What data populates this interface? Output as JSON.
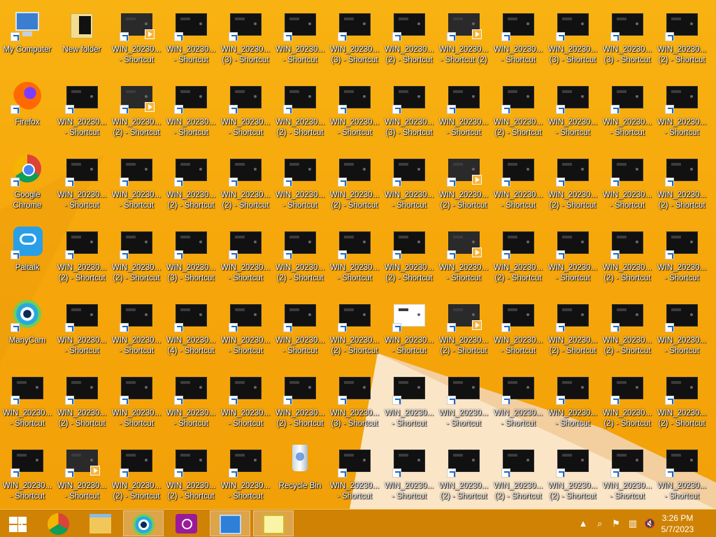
{
  "desktop_icons": [
    {
      "label1": "My Computer",
      "label2": "",
      "icon": "computer-icon",
      "kind": "computer",
      "col": 0,
      "row": 0
    },
    {
      "label1": "New folder",
      "label2": "",
      "icon": "folder-icon",
      "kind": "folder",
      "col": 1,
      "row": 0
    },
    {
      "label1": "WIN_20230...",
      "label2": "- Shortcut",
      "icon": "video-shortcut-icon",
      "kind": "video",
      "col": 2,
      "row": 0
    },
    {
      "label1": "WIN_20230...",
      "label2": "- Shortcut",
      "icon": "image-shortcut-icon",
      "kind": "thumb",
      "col": 3,
      "row": 0
    },
    {
      "label1": "WIN_20230...",
      "label2": "(3) - Shortcut",
      "icon": "image-shortcut-icon",
      "kind": "thumb",
      "col": 4,
      "row": 0
    },
    {
      "label1": "WIN_20230...",
      "label2": "- Shortcut",
      "icon": "image-shortcut-icon",
      "kind": "thumb",
      "col": 5,
      "row": 0
    },
    {
      "label1": "WIN_20230...",
      "label2": "(3) - Shortcut",
      "icon": "image-shortcut-icon",
      "kind": "thumb",
      "col": 6,
      "row": 0
    },
    {
      "label1": "WIN_20230...",
      "label2": "(2) - Shortcut",
      "icon": "image-shortcut-icon",
      "kind": "thumb",
      "col": 7,
      "row": 0
    },
    {
      "label1": "WIN_20230...",
      "label2": "- Shortcut (2)",
      "icon": "video-shortcut-icon",
      "kind": "video",
      "col": 8,
      "row": 0
    },
    {
      "label1": "WIN_20230...",
      "label2": "- Shortcut",
      "icon": "image-shortcut-icon",
      "kind": "thumb",
      "col": 9,
      "row": 0
    },
    {
      "label1": "WIN_20230...",
      "label2": "(3) - Shortcut",
      "icon": "image-shortcut-icon",
      "kind": "thumb",
      "col": 10,
      "row": 0
    },
    {
      "label1": "WIN_20230...",
      "label2": "(3) - Shortcut",
      "icon": "image-shortcut-icon",
      "kind": "thumb",
      "col": 11,
      "row": 0
    },
    {
      "label1": "WIN_20230...",
      "label2": "(2) - Shortcut",
      "icon": "image-shortcut-icon",
      "kind": "thumb",
      "col": 12,
      "row": 0
    },
    {
      "label1": "Firefox",
      "label2": "",
      "icon": "firefox-icon",
      "kind": "firefox",
      "col": 0,
      "row": 1
    },
    {
      "label1": "WIN_20230...",
      "label2": "- Shortcut",
      "icon": "image-shortcut-icon",
      "kind": "thumb",
      "col": 1,
      "row": 1
    },
    {
      "label1": "WIN_20230...",
      "label2": "(2) - Shortcut",
      "icon": "video-shortcut-icon",
      "kind": "video",
      "col": 2,
      "row": 1
    },
    {
      "label1": "WIN_20230...",
      "label2": "- Shortcut",
      "icon": "image-shortcut-icon",
      "kind": "thumb",
      "col": 3,
      "row": 1
    },
    {
      "label1": "WIN_20230...",
      "label2": "- Shortcut",
      "icon": "image-shortcut-icon",
      "kind": "thumb",
      "col": 4,
      "row": 1
    },
    {
      "label1": "WIN_20230...",
      "label2": "(2) - Shortcut",
      "icon": "image-shortcut-icon",
      "kind": "thumb",
      "col": 5,
      "row": 1
    },
    {
      "label1": "WIN_20230...",
      "label2": "- Shortcut",
      "icon": "image-shortcut-icon",
      "kind": "thumb",
      "col": 6,
      "row": 1
    },
    {
      "label1": "WIN_20230...",
      "label2": "(3) - Shortcut",
      "icon": "image-shortcut-icon",
      "kind": "thumb",
      "col": 7,
      "row": 1
    },
    {
      "label1": "WIN_20230...",
      "label2": "- Shortcut",
      "icon": "image-shortcut-icon",
      "kind": "thumb",
      "col": 8,
      "row": 1
    },
    {
      "label1": "WIN_20230...",
      "label2": "(2) - Shortcut",
      "icon": "image-shortcut-icon",
      "kind": "thumb",
      "col": 9,
      "row": 1
    },
    {
      "label1": "WIN_20230...",
      "label2": "- Shortcut",
      "icon": "image-shortcut-icon",
      "kind": "thumb",
      "col": 10,
      "row": 1
    },
    {
      "label1": "WIN_20230...",
      "label2": "- Shortcut",
      "icon": "image-shortcut-icon",
      "kind": "thumb",
      "col": 11,
      "row": 1
    },
    {
      "label1": "WIN_20230...",
      "label2": "- Shortcut",
      "icon": "image-shortcut-icon",
      "kind": "thumb",
      "col": 12,
      "row": 1
    },
    {
      "label1": "Google",
      "label2": "Chrome",
      "icon": "chrome-icon",
      "kind": "chrome",
      "col": 0,
      "row": 2
    },
    {
      "label1": "WIN_20230...",
      "label2": "- Shortcut",
      "icon": "image-shortcut-icon",
      "kind": "thumb",
      "col": 1,
      "row": 2
    },
    {
      "label1": "WIN_20230...",
      "label2": "- Shortcut",
      "icon": "image-shortcut-icon",
      "kind": "thumb",
      "col": 2,
      "row": 2
    },
    {
      "label1": "WIN_20230...",
      "label2": "(2) - Shortcut",
      "icon": "image-shortcut-icon",
      "kind": "thumb",
      "col": 3,
      "row": 2
    },
    {
      "label1": "WIN_20230...",
      "label2": "(2) - Shortcut",
      "icon": "image-shortcut-icon",
      "kind": "thumb",
      "col": 4,
      "row": 2
    },
    {
      "label1": "WIN_20230...",
      "label2": "- Shortcut",
      "icon": "image-shortcut-icon",
      "kind": "thumb",
      "col": 5,
      "row": 2
    },
    {
      "label1": "WIN_20230...",
      "label2": "(2) - Shortcut",
      "icon": "image-shortcut-icon",
      "kind": "thumb",
      "col": 6,
      "row": 2
    },
    {
      "label1": "WIN_20230...",
      "label2": "- Shortcut",
      "icon": "image-shortcut-icon",
      "kind": "thumb",
      "col": 7,
      "row": 2
    },
    {
      "label1": "WIN_20230...",
      "label2": "(2) - Shortcut",
      "icon": "video-shortcut-icon",
      "kind": "video",
      "col": 8,
      "row": 2
    },
    {
      "label1": "WIN_20230...",
      "label2": "- Shortcut",
      "icon": "image-shortcut-icon",
      "kind": "thumb",
      "col": 9,
      "row": 2
    },
    {
      "label1": "WIN_20230...",
      "label2": "(2) - Shortcut",
      "icon": "image-shortcut-icon",
      "kind": "thumb",
      "col": 10,
      "row": 2
    },
    {
      "label1": "WIN_20230...",
      "label2": "- Shortcut",
      "icon": "image-shortcut-icon",
      "kind": "thumb",
      "col": 11,
      "row": 2
    },
    {
      "label1": "WIN_20230...",
      "label2": "(2) - Shortcut",
      "icon": "image-shortcut-icon",
      "kind": "thumb",
      "col": 12,
      "row": 2
    },
    {
      "label1": "Paltalk",
      "label2": "",
      "icon": "paltalk-icon",
      "kind": "paltalk",
      "col": 0,
      "row": 3
    },
    {
      "label1": "WIN_20230...",
      "label2": "(2) - Shortcut",
      "icon": "image-shortcut-icon",
      "kind": "thumb",
      "col": 1,
      "row": 3
    },
    {
      "label1": "WIN_20230...",
      "label2": "(2) - Shortcut",
      "icon": "image-shortcut-icon",
      "kind": "thumb",
      "col": 2,
      "row": 3
    },
    {
      "label1": "WIN_20230...",
      "label2": "(3) - Shortcut",
      "icon": "image-shortcut-icon",
      "kind": "thumb",
      "col": 3,
      "row": 3
    },
    {
      "label1": "WIN_20230...",
      "label2": "- Shortcut",
      "icon": "image-shortcut-icon",
      "kind": "thumb",
      "col": 4,
      "row": 3
    },
    {
      "label1": "WIN_20230...",
      "label2": "(2) - Shortcut",
      "icon": "image-shortcut-icon",
      "kind": "thumb",
      "col": 5,
      "row": 3
    },
    {
      "label1": "WIN_20230...",
      "label2": "- Shortcut",
      "icon": "image-shortcut-icon",
      "kind": "thumb",
      "col": 6,
      "row": 3
    },
    {
      "label1": "WIN_20230...",
      "label2": "(2) - Shortcut",
      "icon": "image-shortcut-icon",
      "kind": "thumb",
      "col": 7,
      "row": 3
    },
    {
      "label1": "WIN_20230...",
      "label2": "- Shortcut",
      "icon": "video-shortcut-icon",
      "kind": "video",
      "col": 8,
      "row": 3
    },
    {
      "label1": "WIN_20230...",
      "label2": "(2) - Shortcut",
      "icon": "image-shortcut-icon",
      "kind": "thumb",
      "col": 9,
      "row": 3
    },
    {
      "label1": "WIN_20230...",
      "label2": "- Shortcut",
      "icon": "image-shortcut-icon",
      "kind": "thumb",
      "col": 10,
      "row": 3
    },
    {
      "label1": "WIN_20230...",
      "label2": "(2) - Shortcut",
      "icon": "image-shortcut-icon",
      "kind": "thumb",
      "col": 11,
      "row": 3
    },
    {
      "label1": "WIN_20230...",
      "label2": "- Shortcut",
      "icon": "image-shortcut-icon",
      "kind": "thumb",
      "col": 12,
      "row": 3
    },
    {
      "label1": "ManyCam",
      "label2": "",
      "icon": "manycam-icon",
      "kind": "manycam",
      "col": 0,
      "row": 4
    },
    {
      "label1": "WIN_20230...",
      "label2": "- Shortcut",
      "icon": "image-shortcut-icon",
      "kind": "thumb",
      "col": 1,
      "row": 4
    },
    {
      "label1": "WIN_20230...",
      "label2": "- Shortcut",
      "icon": "image-shortcut-icon",
      "kind": "thumb",
      "col": 2,
      "row": 4
    },
    {
      "label1": "WIN_20230...",
      "label2": "(4) - Shortcut",
      "icon": "image-shortcut-icon",
      "kind": "thumb",
      "col": 3,
      "row": 4
    },
    {
      "label1": "WIN_20230...",
      "label2": "- Shortcut",
      "icon": "image-shortcut-icon",
      "kind": "thumb",
      "col": 4,
      "row": 4
    },
    {
      "label1": "WIN_20230...",
      "label2": "- Shortcut",
      "icon": "image-shortcut-icon",
      "kind": "thumb",
      "col": 5,
      "row": 4
    },
    {
      "label1": "WIN_20230...",
      "label2": "(2) - Shortcut",
      "icon": "image-shortcut-icon",
      "kind": "thumb",
      "col": 6,
      "row": 4
    },
    {
      "label1": "WIN_20230...",
      "label2": "- Shortcut",
      "icon": "image-shortcut-icon",
      "kind": "white-thumb",
      "col": 7,
      "row": 4
    },
    {
      "label1": "WIN_20230...",
      "label2": "(2) - Shortcut",
      "icon": "video-shortcut-icon",
      "kind": "video",
      "col": 8,
      "row": 4
    },
    {
      "label1": "WIN_20230...",
      "label2": "- Shortcut",
      "icon": "image-shortcut-icon",
      "kind": "thumb",
      "col": 9,
      "row": 4
    },
    {
      "label1": "WIN_20230...",
      "label2": "(2) - Shortcut",
      "icon": "image-shortcut-icon",
      "kind": "thumb",
      "col": 10,
      "row": 4
    },
    {
      "label1": "WIN_20230...",
      "label2": "(2) - Shortcut",
      "icon": "image-shortcut-icon",
      "kind": "thumb",
      "col": 11,
      "row": 4
    },
    {
      "label1": "WIN_20230...",
      "label2": "- Shortcut",
      "icon": "image-shortcut-icon",
      "kind": "thumb",
      "col": 12,
      "row": 4
    },
    {
      "label1": "WIN_20230...",
      "label2": "- Shortcut",
      "icon": "image-shortcut-icon",
      "kind": "thumb",
      "col": 0,
      "row": 5
    },
    {
      "label1": "WIN_20230...",
      "label2": "(2) - Shortcut",
      "icon": "image-shortcut-icon",
      "kind": "thumb",
      "col": 1,
      "row": 5
    },
    {
      "label1": "WIN_20230...",
      "label2": "- Shortcut",
      "icon": "image-shortcut-icon",
      "kind": "thumb",
      "col": 2,
      "row": 5
    },
    {
      "label1": "WIN_20230...",
      "label2": "- Shortcut",
      "icon": "image-shortcut-icon",
      "kind": "thumb",
      "col": 3,
      "row": 5
    },
    {
      "label1": "WIN_20230...",
      "label2": "- Shortcut",
      "icon": "image-shortcut-icon",
      "kind": "thumb",
      "col": 4,
      "row": 5
    },
    {
      "label1": "WIN_20230...",
      "label2": "(2) - Shortcut",
      "icon": "image-shortcut-icon",
      "kind": "thumb",
      "col": 5,
      "row": 5
    },
    {
      "label1": "WIN_20230...",
      "label2": "(3) - Shortcut",
      "icon": "image-shortcut-icon",
      "kind": "thumb",
      "col": 6,
      "row": 5
    },
    {
      "label1": "WIN_20230...",
      "label2": "- Shortcut",
      "icon": "image-shortcut-icon",
      "kind": "thumb",
      "col": 7,
      "row": 5
    },
    {
      "label1": "WIN_20230...",
      "label2": "- Shortcut",
      "icon": "image-shortcut-icon",
      "kind": "thumb",
      "col": 8,
      "row": 5
    },
    {
      "label1": "WIN_20230...",
      "label2": "- Shortcut",
      "icon": "image-shortcut-icon",
      "kind": "thumb",
      "col": 9,
      "row": 5
    },
    {
      "label1": "WIN_20230...",
      "label2": "- Shortcut",
      "icon": "image-shortcut-icon",
      "kind": "thumb",
      "col": 10,
      "row": 5
    },
    {
      "label1": "WIN_20230...",
      "label2": "(2) - Shortcut",
      "icon": "image-shortcut-icon",
      "kind": "thumb",
      "col": 11,
      "row": 5
    },
    {
      "label1": "WIN_20230...",
      "label2": "(2) - Shortcut",
      "icon": "image-shortcut-icon",
      "kind": "thumb",
      "col": 12,
      "row": 5
    },
    {
      "label1": "WIN_20230...",
      "label2": "- Shortcut",
      "icon": "image-shortcut-icon",
      "kind": "thumb",
      "col": 0,
      "row": 6
    },
    {
      "label1": "WIN_20230...",
      "label2": "- Shortcut",
      "icon": "video-shortcut-icon",
      "kind": "video",
      "col": 1,
      "row": 6
    },
    {
      "label1": "WIN_20230...",
      "label2": "(2) - Shortcut",
      "icon": "image-shortcut-icon",
      "kind": "thumb",
      "col": 2,
      "row": 6
    },
    {
      "label1": "WIN_20230...",
      "label2": "(2) - Shortcut",
      "icon": "image-shortcut-icon",
      "kind": "thumb",
      "col": 3,
      "row": 6
    },
    {
      "label1": "WIN_20230...",
      "label2": "- Shortcut",
      "icon": "image-shortcut-icon",
      "kind": "thumb",
      "col": 4,
      "row": 6
    },
    {
      "label1": "Recycle Bin",
      "label2": "",
      "icon": "recycle-bin-icon",
      "kind": "bin",
      "col": 5,
      "row": 6
    },
    {
      "label1": "WIN_20230...",
      "label2": "- Shortcut",
      "icon": "image-shortcut-icon",
      "kind": "thumb",
      "col": 6,
      "row": 6
    },
    {
      "label1": "WIN_20230...",
      "label2": "- Shortcut",
      "icon": "image-shortcut-icon",
      "kind": "thumb",
      "col": 7,
      "row": 6
    },
    {
      "label1": "WIN_20230...",
      "label2": "(2) - Shortcut",
      "icon": "image-shortcut-icon",
      "kind": "thumb",
      "col": 8,
      "row": 6
    },
    {
      "label1": "WIN_20230...",
      "label2": "(2) - Shortcut",
      "icon": "image-shortcut-icon",
      "kind": "thumb",
      "col": 9,
      "row": 6
    },
    {
      "label1": "WIN_20230...",
      "label2": "(2) - Shortcut",
      "icon": "image-shortcut-icon",
      "kind": "thumb",
      "col": 10,
      "row": 6
    },
    {
      "label1": "WIN_20230...",
      "label2": "- Shortcut",
      "icon": "image-shortcut-icon",
      "kind": "thumb",
      "col": 11,
      "row": 6
    },
    {
      "label1": "WIN_20230...",
      "label2": "- Shortcut",
      "icon": "image-shortcut-icon",
      "kind": "thumb",
      "col": 12,
      "row": 6
    }
  ],
  "taskbar": {
    "buttons": [
      {
        "name": "start-button",
        "icon": "windows-logo-icon"
      },
      {
        "name": "taskbar-chrome-button",
        "icon": "chrome-icon"
      },
      {
        "name": "taskbar-file-explorer-button",
        "icon": "file-explorer-icon"
      },
      {
        "name": "taskbar-manycam-button",
        "icon": "manycam-icon"
      },
      {
        "name": "taskbar-camera-button",
        "icon": "camera-icon"
      },
      {
        "name": "taskbar-control-panel-button",
        "icon": "control-panel-icon"
      },
      {
        "name": "taskbar-notepad-plus-plus-button",
        "icon": "notepad-plus-plus-icon"
      }
    ],
    "tray": {
      "icons": [
        "show-hidden-icons-icon",
        "search-icon",
        "action-center-icon",
        "network-icon",
        "volume-muted-icon"
      ],
      "time": "3:26 PM",
      "date": "5/7/2023"
    }
  },
  "colors": {
    "wallpaper": "#f6a80a",
    "taskbar": "#d08204",
    "label_text": "#ffffff"
  }
}
